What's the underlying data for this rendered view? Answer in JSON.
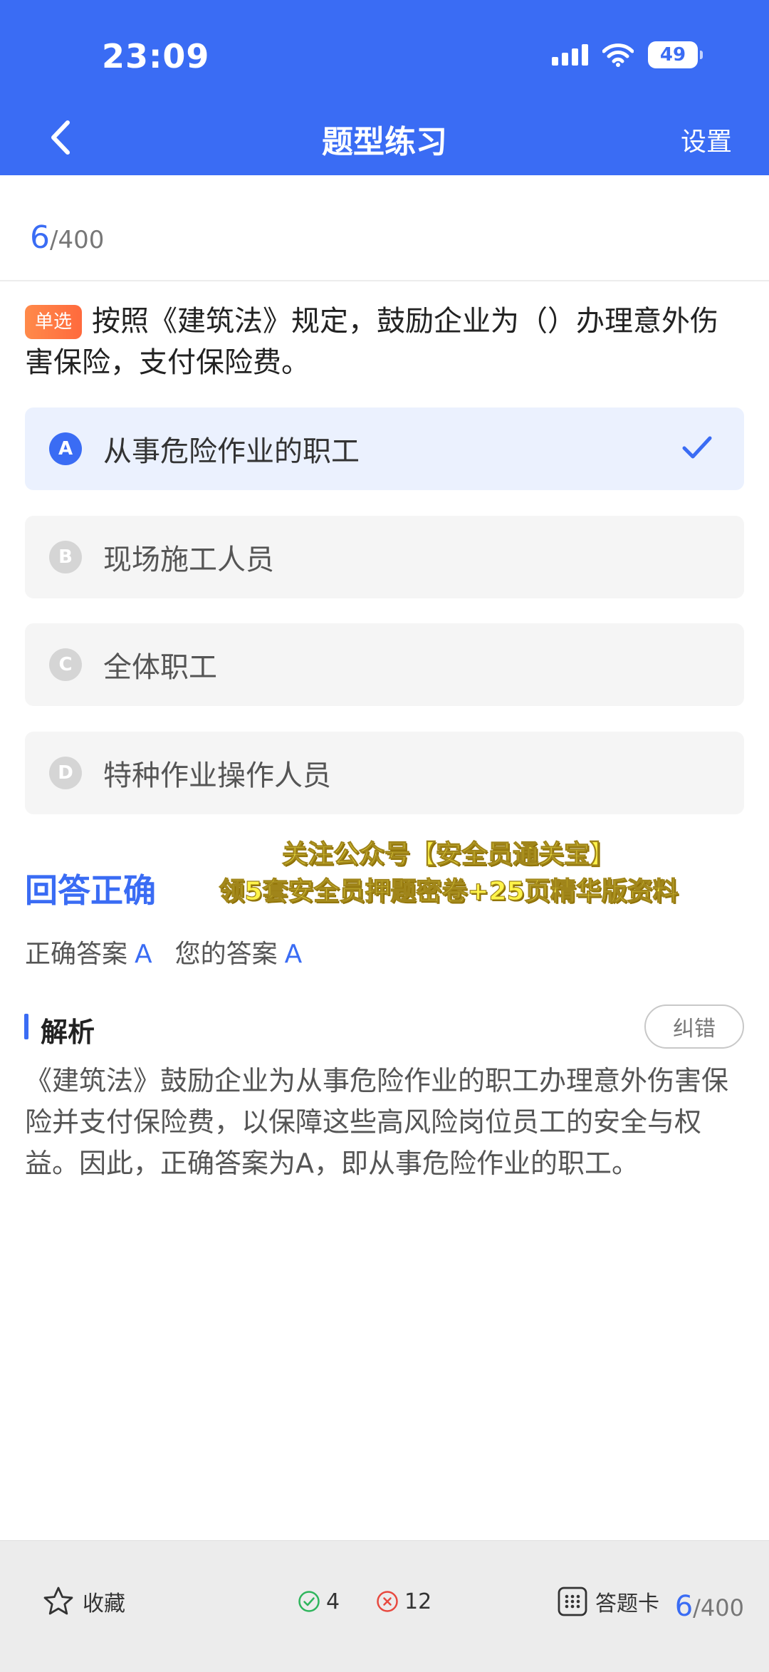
{
  "status_bar": {
    "time": "23:09",
    "battery": "49"
  },
  "header": {
    "title": "题型练习",
    "settings_label": "设置"
  },
  "progress": {
    "current": "6",
    "total": "/400"
  },
  "question": {
    "type_tag": "单选",
    "text": "按照《建筑法》规定，鼓励企业为（）办理意外伤害保险，支付保险费。"
  },
  "options": [
    {
      "letter": "A",
      "text": "从事危险作业的职工",
      "selected": true
    },
    {
      "letter": "B",
      "text": "现场施工人员",
      "selected": false
    },
    {
      "letter": "C",
      "text": "全体职工",
      "selected": false
    },
    {
      "letter": "D",
      "text": "特种作业操作人员",
      "selected": false
    }
  ],
  "result": {
    "label": "回答正确",
    "correct_answer_label": "正确答案",
    "correct_answer": "A",
    "your_answer_label": "您的答案",
    "your_answer": "A"
  },
  "promo": {
    "line1": "关注公众号【安全员通关宝】",
    "line2": "领5套安全员押题密卷+25页精华版资料"
  },
  "analysis": {
    "title": "解析",
    "report_label": "纠错",
    "text": "《建筑法》鼓励企业为从事危险作业的职工办理意外伤害保险并支付保险费，以保障这些高风险岗位员工的安全与权益。因此，正确答案为A，即从事危险作业的职工。"
  },
  "bottom_bar": {
    "favorite_label": "收藏",
    "right_count": "4",
    "wrong_count": "12",
    "card_label": "答题卡",
    "progress_current": "6",
    "progress_total": "/400"
  },
  "colors": {
    "accent": "#3a6cf4",
    "tag": "#ff7a45",
    "correct": "#2fb55d",
    "wrong": "#e8493f"
  }
}
